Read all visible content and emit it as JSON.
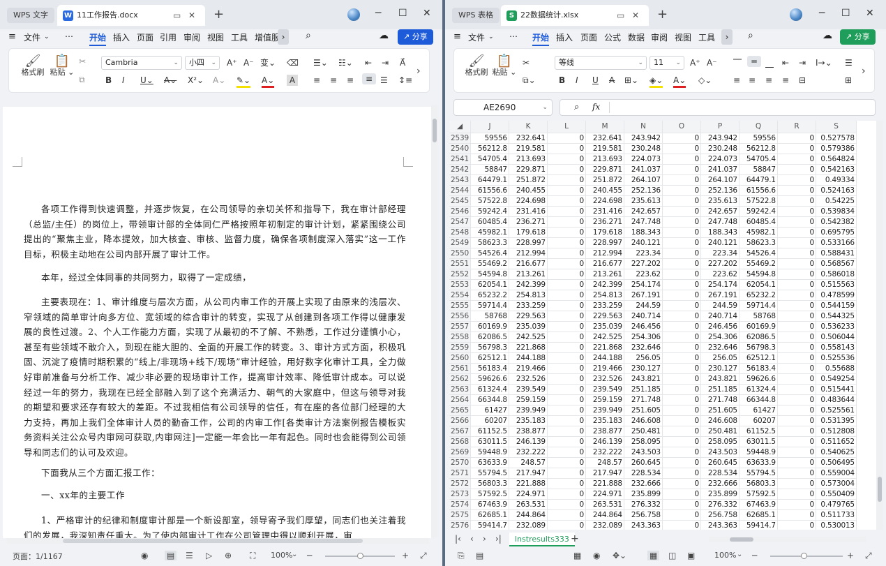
{
  "writer": {
    "app_tab": "WPS 文字",
    "doc_tab": "11工作报告.docx",
    "doc_icon": "W",
    "menu": [
      "文件",
      "⋯",
      "开始",
      "插入",
      "页面",
      "引用",
      "审阅",
      "视图",
      "工具",
      "增值服"
    ],
    "share": "分享",
    "ribbon": {
      "format_painter": "格式刷",
      "paste": "粘贴",
      "font": "Cambria",
      "size": "小四"
    },
    "paragraphs": [
      "各项工作得到快速调整，并逐步恢复，在公司领导的亲切关怀和指导下，我在审计部经理（总监/主任）的岗位上，带领审计部的全体同仁严格按照年初制定的审计计划，紧紧围绕公司提出的“聚焦主业，降本提效，加大核查、审核、监督力度，确保各项制度深入落实”这一工作目标，积极主动地在公司内部开展了审计工作。",
      "本年，经过全体同事的共同努力，取得了一定成绩，",
      "主要表现在：1、审计维度与层次方面，从公司内审工作的开展上实现了由原来的浅层次、窄领域的简单审计向多方位、宽领域的综合审计的转变，实现了从创建到各项工作得以健康发展的良性过渡。2、个人工作能力方面，实现了从最初的不了解、不熟悉，工作过分谨慎小心，甚至有些领域不敢介入，到现在能大胆的、全面的开展工作的转变。3、审计方式方面，积极巩固、沉淀了疫情时期积累的“线上/非现场+线下/现场”审计经验，用好数字化审计工具，全力做好审前准备与分析工作、减少非必要的现场审计工作，提高审计效率、降低审计成本。可以说经过一年的努力，我现在已经全部融入到了这个充满活力、朝气的大家庭中，但这与领导对我的期望和要求还存有较大的差距。不过我相信有公司领导的信任，有在座的各位部门经理的大力支持，再加上我们全体审计人员的勤奋工作，公司的内审工作[各类审计方法案例报告模板实务资料关注公众号内审网可获取,内审网注]一定能一年会比一年有起色。同时也会能得到公司领导和同志们的认可及欢迎。",
      "下面我从三个方面汇报工作：",
      "一、xx年的主要工作",
      "1、严格审计的纪律和制度审计部是一个新设部室，领导寄予我们厚望，同志们也关注着我们的发展，我深知责任重大。为了使内部审计工作在公司管理中得以顺利开展，审"
    ],
    "status": {
      "page": "页面：1/1167",
      "zoom": "100%"
    }
  },
  "calc": {
    "app_tab": "WPS 表格",
    "doc_tab": "22数据统计.xlsx",
    "doc_icon": "S",
    "menu": [
      "文件",
      "⋯",
      "开始",
      "插入",
      "页面",
      "公式",
      "数据",
      "审阅",
      "视图",
      "工具"
    ],
    "share": "分享",
    "ribbon": {
      "format_painter": "格式刷",
      "paste": "粘贴",
      "font": "等线",
      "size": "11"
    },
    "cell_ref": "AE2690",
    "fx": "fx",
    "columns": [
      "J",
      "K",
      "L",
      "M",
      "N",
      "O",
      "P",
      "Q",
      "R",
      "S"
    ],
    "rows": [
      [
        "2539",
        "59556",
        "232.641",
        "0",
        "232.641",
        "243.942",
        "0",
        "243.942",
        "59556",
        "0",
        "0.527578"
      ],
      [
        "2540",
        "56212.8",
        "219.581",
        "0",
        "219.581",
        "230.248",
        "0",
        "230.248",
        "56212.8",
        "0",
        "0.579386"
      ],
      [
        "2541",
        "54705.4",
        "213.693",
        "0",
        "213.693",
        "224.073",
        "0",
        "224.073",
        "54705.4",
        "0",
        "0.564824"
      ],
      [
        "2542",
        "58847",
        "229.871",
        "0",
        "229.871",
        "241.037",
        "0",
        "241.037",
        "58847",
        "0",
        "0.542163"
      ],
      [
        "2543",
        "64479.1",
        "251.872",
        "0",
        "251.872",
        "264.107",
        "0",
        "264.107",
        "64479.1",
        "0",
        "0.49334"
      ],
      [
        "2544",
        "61556.6",
        "240.455",
        "0",
        "240.455",
        "252.136",
        "0",
        "252.136",
        "61556.6",
        "0",
        "0.524163"
      ],
      [
        "2545",
        "57522.8",
        "224.698",
        "0",
        "224.698",
        "235.613",
        "0",
        "235.613",
        "57522.8",
        "0",
        "0.54225"
      ],
      [
        "2546",
        "59242.4",
        "231.416",
        "0",
        "231.416",
        "242.657",
        "0",
        "242.657",
        "59242.4",
        "0",
        "0.539834"
      ],
      [
        "2547",
        "60485.4",
        "236.271",
        "0",
        "236.271",
        "247.748",
        "0",
        "247.748",
        "60485.4",
        "0",
        "0.542382"
      ],
      [
        "2548",
        "45982.1",
        "179.618",
        "0",
        "179.618",
        "188.343",
        "0",
        "188.343",
        "45982.1",
        "0",
        "0.695795"
      ],
      [
        "2549",
        "58623.3",
        "228.997",
        "0",
        "228.997",
        "240.121",
        "0",
        "240.121",
        "58623.3",
        "0",
        "0.533166"
      ],
      [
        "2550",
        "54526.4",
        "212.994",
        "0",
        "212.994",
        "223.34",
        "0",
        "223.34",
        "54526.4",
        "0",
        "0.588431"
      ],
      [
        "2551",
        "55469.2",
        "216.677",
        "0",
        "216.677",
        "227.202",
        "0",
        "227.202",
        "55469.2",
        "0",
        "0.568567"
      ],
      [
        "2552",
        "54594.8",
        "213.261",
        "0",
        "213.261",
        "223.62",
        "0",
        "223.62",
        "54594.8",
        "0",
        "0.586018"
      ],
      [
        "2553",
        "62054.1",
        "242.399",
        "0",
        "242.399",
        "254.174",
        "0",
        "254.174",
        "62054.1",
        "0",
        "0.515563"
      ],
      [
        "2554",
        "65232.2",
        "254.813",
        "0",
        "254.813",
        "267.191",
        "0",
        "267.191",
        "65232.2",
        "0",
        "0.478599"
      ],
      [
        "2555",
        "59714.4",
        "233.259",
        "0",
        "233.259",
        "244.59",
        "0",
        "244.59",
        "59714.4",
        "0",
        "0.544159"
      ],
      [
        "2556",
        "58768",
        "229.563",
        "0",
        "229.563",
        "240.714",
        "0",
        "240.714",
        "58768",
        "0",
        "0.544325"
      ],
      [
        "2557",
        "60169.9",
        "235.039",
        "0",
        "235.039",
        "246.456",
        "0",
        "246.456",
        "60169.9",
        "0",
        "0.536233"
      ],
      [
        "2558",
        "62086.5",
        "242.525",
        "0",
        "242.525",
        "254.306",
        "0",
        "254.306",
        "62086.5",
        "0",
        "0.506044"
      ],
      [
        "2559",
        "56798.3",
        "221.868",
        "0",
        "221.868",
        "232.646",
        "0",
        "232.646",
        "56798.3",
        "0",
        "0.558143"
      ],
      [
        "2560",
        "62512.1",
        "244.188",
        "0",
        "244.188",
        "256.05",
        "0",
        "256.05",
        "62512.1",
        "0",
        "0.525536"
      ],
      [
        "2561",
        "56183.4",
        "219.466",
        "0",
        "219.466",
        "230.127",
        "0",
        "230.127",
        "56183.4",
        "0",
        "0.55688"
      ],
      [
        "2562",
        "59626.6",
        "232.526",
        "0",
        "232.526",
        "243.821",
        "0",
        "243.821",
        "59626.6",
        "0",
        "0.549254"
      ],
      [
        "2563",
        "61324.4",
        "239.549",
        "0",
        "239.549",
        "251.185",
        "0",
        "251.185",
        "61324.4",
        "0",
        "0.515441"
      ],
      [
        "2564",
        "66344.8",
        "259.159",
        "0",
        "259.159",
        "271.748",
        "0",
        "271.748",
        "66344.8",
        "0",
        "0.483644"
      ],
      [
        "2565",
        "61427",
        "239.949",
        "0",
        "239.949",
        "251.605",
        "0",
        "251.605",
        "61427",
        "0",
        "0.525561"
      ],
      [
        "2566",
        "60207",
        "235.183",
        "0",
        "235.183",
        "246.608",
        "0",
        "246.608",
        "60207",
        "0",
        "0.531395"
      ],
      [
        "2567",
        "61152.5",
        "238.877",
        "0",
        "238.877",
        "250.481",
        "0",
        "250.481",
        "61152.5",
        "0",
        "0.512808"
      ],
      [
        "2568",
        "63011.5",
        "246.139",
        "0",
        "246.139",
        "258.095",
        "0",
        "258.095",
        "63011.5",
        "0",
        "0.511652"
      ],
      [
        "2569",
        "59448.9",
        "232.222",
        "0",
        "232.222",
        "243.503",
        "0",
        "243.503",
        "59448.9",
        "0",
        "0.540625"
      ],
      [
        "2570",
        "63633.9",
        "248.57",
        "0",
        "248.57",
        "260.645",
        "0",
        "260.645",
        "63633.9",
        "0",
        "0.506495"
      ],
      [
        "2571",
        "55794.5",
        "217.947",
        "0",
        "217.947",
        "228.534",
        "0",
        "228.534",
        "55794.5",
        "0",
        "0.559004"
      ],
      [
        "2572",
        "56803.3",
        "221.888",
        "0",
        "221.888",
        "232.666",
        "0",
        "232.666",
        "56803.3",
        "0",
        "0.573004"
      ],
      [
        "2573",
        "57592.5",
        "224.971",
        "0",
        "224.971",
        "235.899",
        "0",
        "235.899",
        "57592.5",
        "0",
        "0.550409"
      ],
      [
        "2574",
        "67463.9",
        "263.531",
        "0",
        "263.531",
        "276.332",
        "0",
        "276.332",
        "67463.9",
        "0",
        "0.479765"
      ],
      [
        "2575",
        "62685.1",
        "244.864",
        "0",
        "244.864",
        "256.758",
        "0",
        "256.758",
        "62685.1",
        "0",
        "0.511733"
      ],
      [
        "2576",
        "59414.7",
        "232.089",
        "0",
        "232.089",
        "243.363",
        "0",
        "243.363",
        "59414.7",
        "0",
        "0.530013"
      ]
    ],
    "sheet_tab": "lnstresults333",
    "zoom": "100%"
  },
  "colors": {
    "accent": "#1e5bd9",
    "writer_icon": "#2a6ae0",
    "calc_icon": "#1e9e5a",
    "calc_share": "#1e9e5a"
  }
}
